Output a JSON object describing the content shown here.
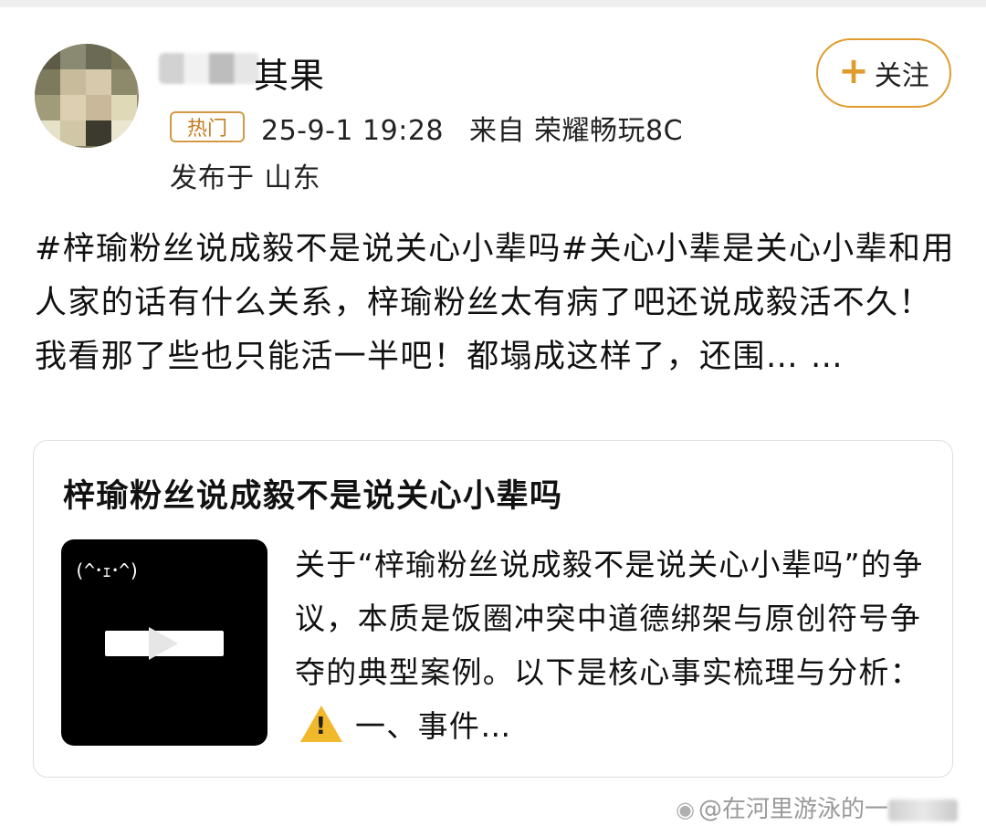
{
  "author": {
    "name_visible_suffix": "其果",
    "badge": "热门",
    "timestamp": "25-9-1 19:28",
    "source": "来自 荣耀畅玩8C",
    "location": "发布于 山东"
  },
  "follow_button": {
    "label": "关注",
    "icon": "plus-icon"
  },
  "post": {
    "text": "#梓瑜粉丝说成毅不是说关心小辈吗#关心小辈是关心小辈和用人家的话有什么关系，梓瑜粉丝太有病了吧还说成毅活不久！我看那了些也只能活一半吧！都塌成这样了，还围… …"
  },
  "card": {
    "title": "梓瑜粉丝说成毅不是说关心小辈吗",
    "thumbnail_text": "(^･ｪ･^)",
    "description_before": "关于“梓瑜粉丝说成毅不是说关心小辈吗”的争议，本质是饭圈冲突中道德绑架与原创符号争夺的典型案例。以下是核心事实梳理与分析：",
    "warning_icon": "warning-icon",
    "description_after": "一、事件…"
  },
  "watermark": {
    "text": "@在河里游泳的一",
    "icon": "weibo-icon"
  },
  "colors": {
    "accent": "#e09b2e",
    "badge": "#c47c20",
    "warning": "#f2b82b"
  }
}
